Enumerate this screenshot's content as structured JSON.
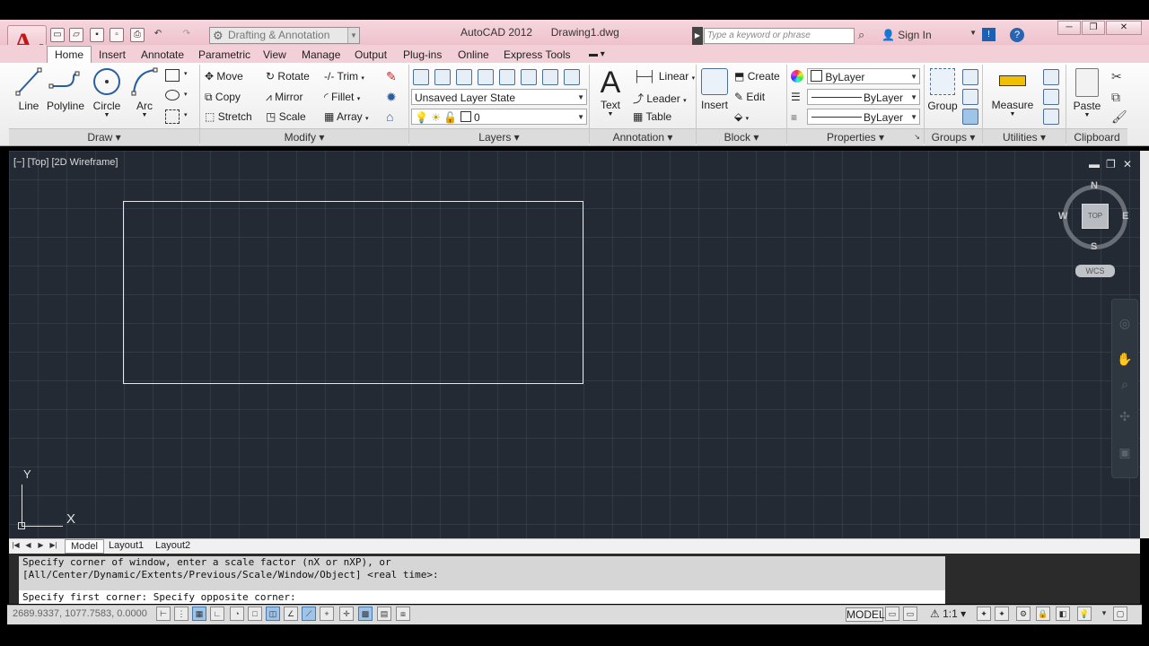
{
  "title_bar": {
    "app_name": "AutoCAD 2012",
    "file_name": "Drawing1.dwg",
    "workspace": "Drafting & Annotation",
    "search_placeholder": "Type a keyword or phrase",
    "sign_in": "Sign In"
  },
  "tabs": [
    "Home",
    "Insert",
    "Annotate",
    "Parametric",
    "View",
    "Manage",
    "Output",
    "Plug-ins",
    "Online",
    "Express Tools"
  ],
  "draw_panel": {
    "label": "Draw",
    "line": "Line",
    "polyline": "Polyline",
    "circle": "Circle",
    "arc": "Arc"
  },
  "modify_panel": {
    "label": "Modify",
    "move": "Move",
    "rotate": "Rotate",
    "trim": "Trim",
    "copy": "Copy",
    "mirror": "Mirror",
    "fillet": "Fillet",
    "stretch": "Stretch",
    "scale": "Scale",
    "array": "Array"
  },
  "layers_panel": {
    "label": "Layers",
    "layer_state": "Unsaved Layer State",
    "current_layer": "0"
  },
  "annotation_panel": {
    "label": "Annotation",
    "text": "Text",
    "linear": "Linear",
    "leader": "Leader",
    "table": "Table"
  },
  "block_panel": {
    "label": "Block",
    "insert": "Insert",
    "create": "Create",
    "edit": "Edit"
  },
  "properties_panel": {
    "label": "Properties",
    "color": "ByLayer",
    "linetype": "ByLayer",
    "lineweight": "ByLayer"
  },
  "groups_panel": {
    "label": "Groups",
    "group": "Group"
  },
  "utilities_panel": {
    "label": "Utilities",
    "measure": "Measure"
  },
  "clipboard_panel": {
    "label": "Clipboard",
    "paste": "Paste"
  },
  "viewport": {
    "label": "[−] [Top] [2D Wireframe]",
    "viewcube_face": "TOP",
    "compass_n": "N",
    "compass_s": "S",
    "compass_e": "E",
    "compass_w": "W",
    "wcs": "WCS",
    "ucs_x": "X",
    "ucs_y": "Y"
  },
  "layout_tabs": [
    "Model",
    "Layout1",
    "Layout2"
  ],
  "command": {
    "history_line1": "Specify corner of window, enter a scale factor (nX or nXP), or",
    "history_line2": "[All/Center/Dynamic/Extents/Previous/Scale/Window/Object] <real time>:",
    "current": "Specify first corner: Specify opposite corner:"
  },
  "status_bar": {
    "coordinates": "2689.9337, 1077.7583, 0.0000",
    "model": "MODEL",
    "annotation_scale": "1:1"
  },
  "colors": {
    "title_bar": "#f0c8d1",
    "canvas": "#232a33",
    "accent_red": "#c81414"
  }
}
